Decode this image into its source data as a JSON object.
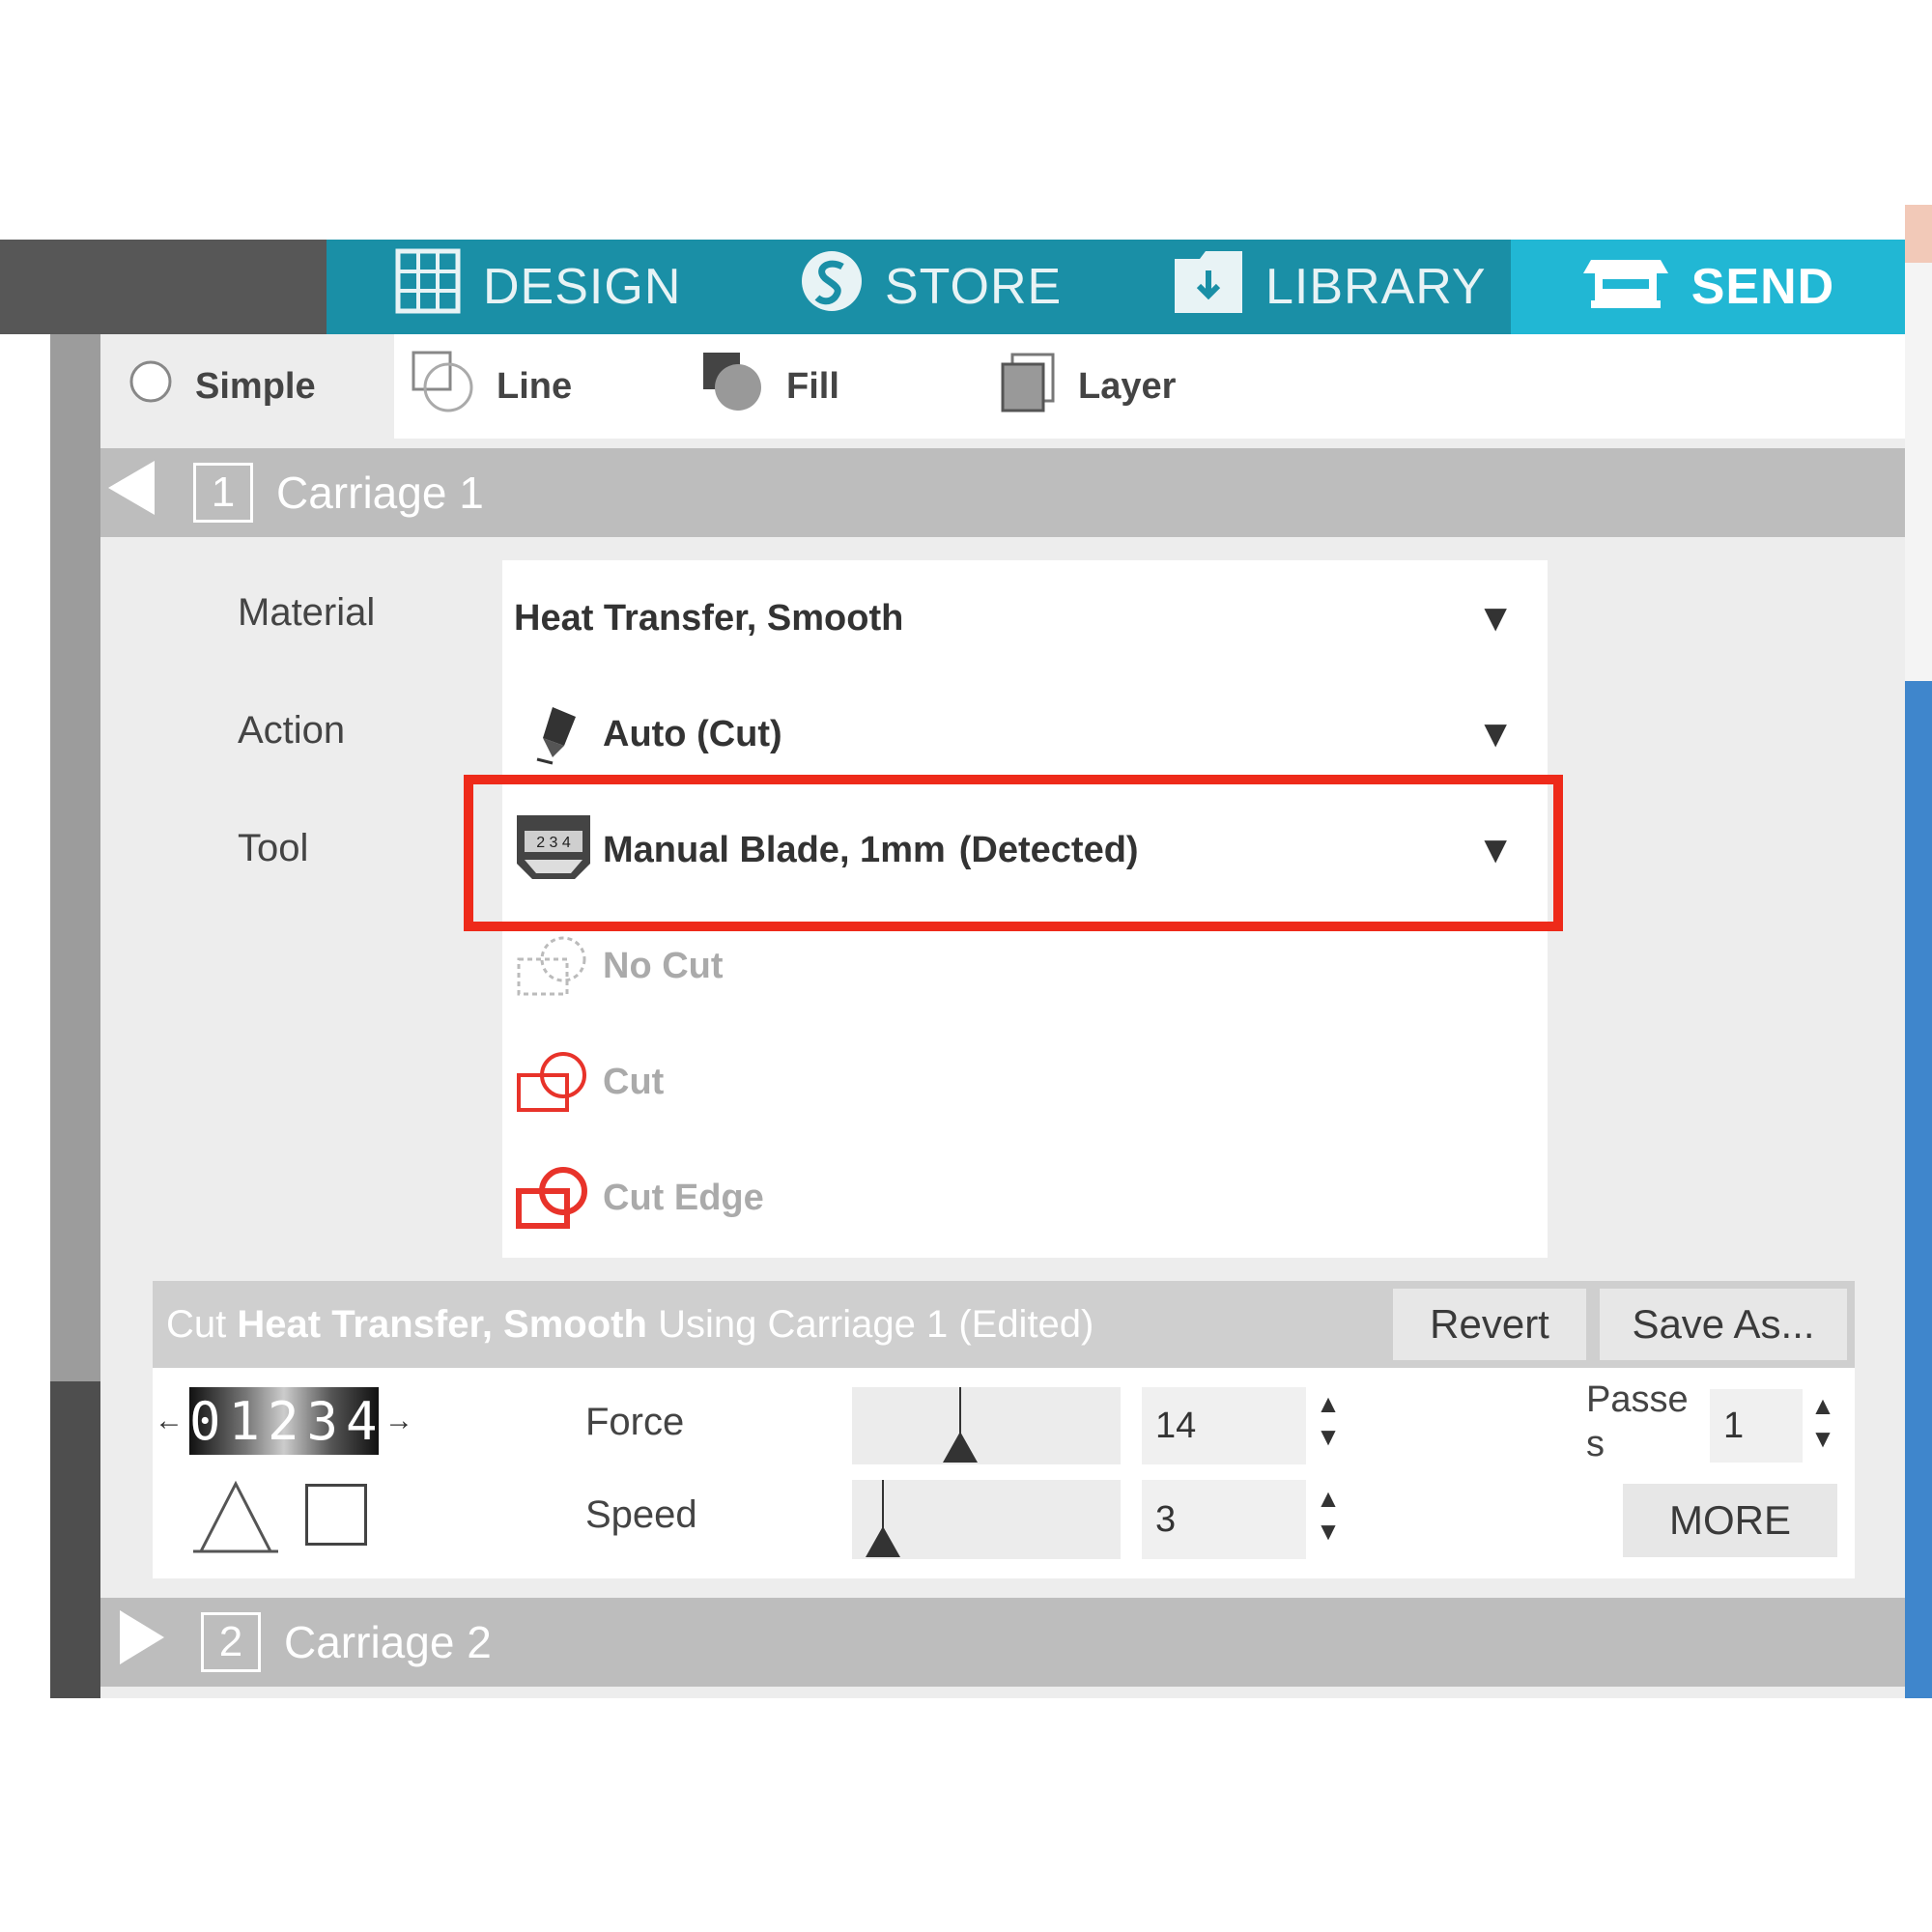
{
  "nav": {
    "tabs": [
      {
        "label": "DESIGN",
        "icon": "grid-icon"
      },
      {
        "label": "STORE",
        "icon": "store-s-icon"
      },
      {
        "label": "LIBRARY",
        "icon": "download-icon"
      },
      {
        "label": "SEND",
        "icon": "cutter-icon",
        "active": true
      }
    ]
  },
  "modes": {
    "simple": "Simple",
    "line": "Line",
    "fill": "Fill",
    "layer": "Layer"
  },
  "carriage1": {
    "number": "1",
    "title": "Carriage 1",
    "labels": {
      "material": "Material",
      "action": "Action",
      "tool": "Tool"
    },
    "material": "Heat Transfer, Smooth",
    "action": "Auto (Cut)",
    "tool": "Manual Blade, 1mm",
    "tool_status": "(Detected)",
    "cut_options": [
      "No Cut",
      "Cut",
      "Cut Edge"
    ]
  },
  "status": {
    "prefix": "Cut",
    "material": "Heat Transfer, Smooth",
    "suffix": "Using Carriage 1 (Edited)",
    "revert": "Revert",
    "save_as": "Save As..."
  },
  "settings": {
    "blade_digits": "01234",
    "force_label": "Force",
    "force_value": "14",
    "speed_label": "Speed",
    "speed_value": "3",
    "passes_label_1": "Passe",
    "passes_label_2": "s",
    "passes_value": "1",
    "more": "MORE"
  },
  "carriage2": {
    "number": "2",
    "title": "Carriage 2"
  },
  "colors": {
    "nav": "#1a8fa6",
    "nav_active": "#21b7d4",
    "detected": "#2aa7cf",
    "highlight": "#ee2a1a",
    "cut_icon": "#e8332a"
  }
}
